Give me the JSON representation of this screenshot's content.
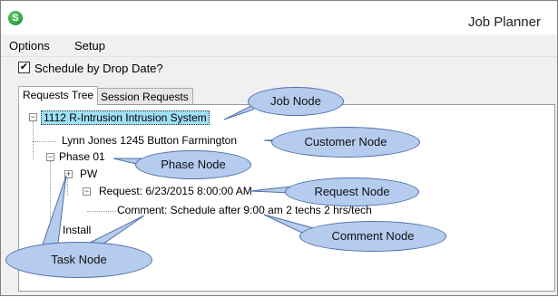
{
  "window": {
    "title": "Job Planner",
    "app_icon_letter": "S"
  },
  "menu": {
    "items": [
      "Options",
      "Setup"
    ]
  },
  "toolbar": {
    "checkbox_label": "Schedule by Drop Date?",
    "checked_mark": "✔"
  },
  "tabs": [
    {
      "label": "Requests Tree"
    },
    {
      "label": "Session Requests"
    }
  ],
  "tree": {
    "job": "1112  R-Intrusion  Intrusion System",
    "customer": "Lynn Jones  1245 Button  Farmington",
    "phase": "Phase 01",
    "task_pw": "PW",
    "request": "Request: 6/23/2015 8:00:00 AM",
    "comment": "Comment: Schedule after 9:00 am 2 techs 2 hrs/tech",
    "task_install": "Install",
    "expand_minus": "−",
    "expand_plus": "+"
  },
  "callouts": {
    "job": "Job Node",
    "customer": "Customer Node",
    "phase": "Phase Node",
    "request": "Request Node",
    "comment": "Comment Node",
    "task": "Task Node"
  }
}
